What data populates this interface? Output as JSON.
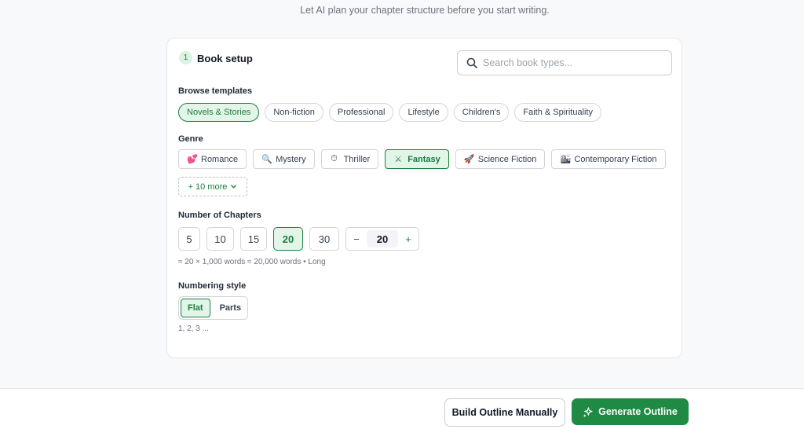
{
  "header": {
    "subtitle": "Let AI plan your chapter structure before you start writing."
  },
  "book_setup": {
    "step": "1",
    "title": "Book setup",
    "search": {
      "placeholder": "Search book types..."
    },
    "templates": {
      "label": "Browse templates",
      "items": [
        "Novels & Stories",
        "Non-fiction",
        "Professional",
        "Lifestyle",
        "Children's",
        "Faith & Spirituality"
      ],
      "selected": "Novels & Stories"
    },
    "genre": {
      "label": "Genre",
      "items": [
        {
          "label": "Romance",
          "icon": "heart-icon",
          "glyph": "💕"
        },
        {
          "label": "Mystery",
          "icon": "magnifier-icon",
          "glyph": "🔍"
        },
        {
          "label": "Thriller",
          "icon": "stopwatch-icon",
          "glyph": "⏱"
        },
        {
          "label": "Fantasy",
          "icon": "crossed-swords-icon",
          "glyph": "⚔"
        },
        {
          "label": "Science Fiction",
          "icon": "rocket-icon",
          "glyph": "🚀"
        },
        {
          "label": "Contemporary Fiction",
          "icon": "buildings-icon",
          "glyph": "🏙"
        }
      ],
      "selected": "Fantasy",
      "more_label": "+ 10 more"
    },
    "chapters": {
      "label": "Number of Chapters",
      "options": [
        "5",
        "10",
        "15",
        "20",
        "30"
      ],
      "selected": "20",
      "stepper": {
        "minus": "−",
        "value": "20",
        "plus": "+"
      },
      "estimate": "≈ 20 × 1,000 words ≈ 20,000 words • Long"
    },
    "numbering": {
      "label": "Numbering style",
      "options": [
        "Flat",
        "Parts"
      ],
      "selected": "Flat",
      "example": "1, 2, 3 ..."
    }
  },
  "footer": {
    "build_manually_label": "Build Outline Manually",
    "generate_label": "Generate Outline"
  },
  "colors": {
    "accent": "#1e8a43",
    "accent_light": "#e3f4e9"
  }
}
